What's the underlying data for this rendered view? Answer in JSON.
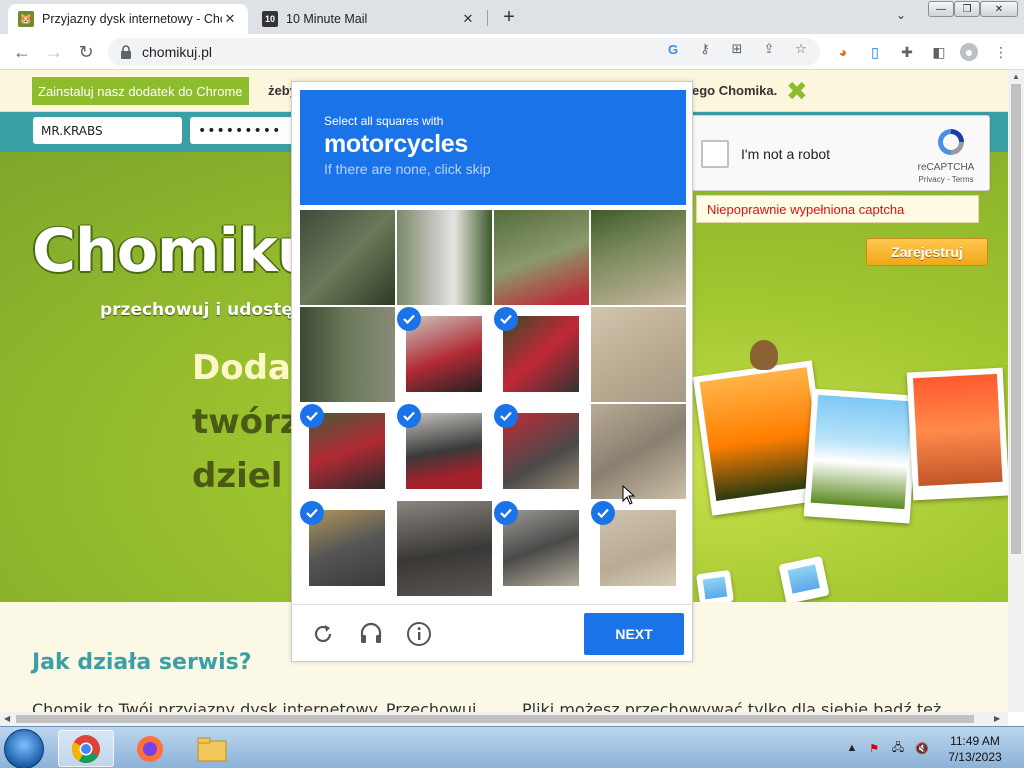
{
  "browser": {
    "tabs": [
      {
        "title": "Przyjazny dysk internetowy - Chomikuj.pl",
        "active": true
      },
      {
        "title": "10 Minute Mail",
        "favicon_text": "10",
        "active": false
      }
    ],
    "url": "chomikuj.pl",
    "window_controls": {
      "minimize": "—",
      "restore": "❐",
      "close": "✕"
    }
  },
  "page": {
    "infobar": {
      "install_button": "Zainstaluj nasz dodatek do Chrome",
      "text_left": "żeby",
      "text_right": "ego Chomika."
    },
    "login": {
      "username_value": "MR.KRABS",
      "password_value": "•••••••••"
    },
    "hero": {
      "logo": "Chomikuj.",
      "tagline": "przechowuj i udostępni",
      "lines": [
        "Dodaw",
        "twórz",
        "dziel s"
      ],
      "line_colors": [
        "#fdf7c8",
        "#4a5a14",
        "#4a5a14"
      ],
      "register_button": "Zarejestruj"
    },
    "lower": {
      "title": "Jak działa serwis?",
      "text_left": "Chomik to Twój przyjazny dysk internetowy. Przechowuj",
      "text_right": "Pliki możesz przechowywać tylko dla siebie bądź też"
    }
  },
  "recaptcha": {
    "anchor_label": "I'm not a robot",
    "brand": "reCAPTCHA",
    "terms": "Privacy - Terms",
    "error": "Niepoprawnie wypełniona captcha",
    "challenge": {
      "instruction": "Select all squares with",
      "target": "motorcycles",
      "hint": "If there are none, click skip",
      "next_button": "NEXT",
      "selected_tiles": [
        false,
        false,
        false,
        false,
        false,
        true,
        true,
        false,
        true,
        true,
        true,
        false,
        true,
        false,
        true,
        true
      ]
    }
  },
  "taskbar": {
    "time": "11:49 AM",
    "date": "7/13/2023"
  },
  "colors": {
    "captcha_blue": "#1a73e8",
    "site_green": "#8dbd2d",
    "site_teal": "#3aa0a6",
    "error_red": "#dd1111"
  }
}
